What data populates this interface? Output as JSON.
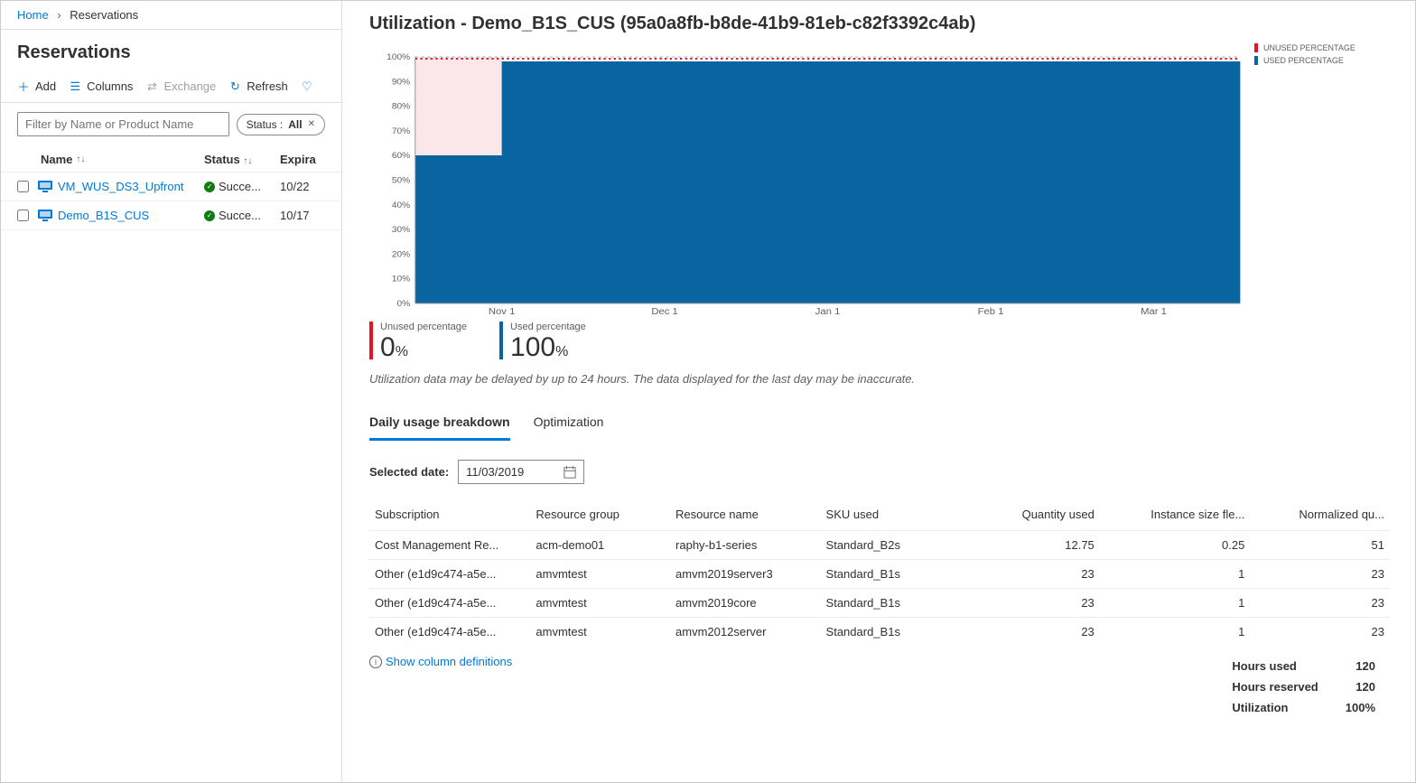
{
  "breadcrumb": {
    "home": "Home",
    "current": "Reservations"
  },
  "left": {
    "title": "Reservations",
    "toolbar": {
      "add": "Add",
      "columns": "Columns",
      "exchange": "Exchange",
      "refresh": "Refresh"
    },
    "filter_placeholder": "Filter by Name or Product Name",
    "status_pill_label": "Status :",
    "status_pill_value": "All",
    "headers": {
      "name": "Name",
      "status": "Status",
      "expir": "Expira"
    },
    "rows": [
      {
        "name": "VM_WUS_DS3_Upfront",
        "status": "Succe...",
        "expir": "10/22"
      },
      {
        "name": "Demo_B1S_CUS",
        "status": "Succe...",
        "expir": "10/17"
      }
    ]
  },
  "detail": {
    "title": "Utilization - Demo_B1S_CUS (95a0a8fb-b8de-41b9-81eb-c82f3392c4ab)",
    "legend": {
      "unused": "UNUSED PERCENTAGE",
      "used": "USED PERCENTAGE"
    },
    "metrics": {
      "unused_label": "Unused percentage",
      "unused_value": "0",
      "unused_unit": "%",
      "used_label": "Used percentage",
      "used_value": "100",
      "used_unit": "%"
    },
    "disclaimer": "Utilization data may be delayed by up to 24 hours. The data displayed for the last day may be inaccurate.",
    "tabs": {
      "breakdown": "Daily usage breakdown",
      "optimization": "Optimization"
    },
    "selected_date_label": "Selected date:",
    "selected_date_value": "11/03/2019",
    "columns": [
      "Subscription",
      "Resource group",
      "Resource name",
      "SKU used",
      "Quantity used",
      "Instance size fle...",
      "Normalized qu..."
    ],
    "usage_rows": [
      {
        "sub": "Cost Management Re...",
        "rg": "acm-demo01",
        "res": "raphy-b1-series",
        "sku": "Standard_B2s",
        "qty": "12.75",
        "flex": "0.25",
        "norm": "51"
      },
      {
        "sub": "Other (e1d9c474-a5e...",
        "rg": "amvmtest",
        "res": "amvm2019server3",
        "sku": "Standard_B1s",
        "qty": "23",
        "flex": "1",
        "norm": "23"
      },
      {
        "sub": "Other (e1d9c474-a5e...",
        "rg": "amvmtest",
        "res": "amvm2019core",
        "sku": "Standard_B1s",
        "qty": "23",
        "flex": "1",
        "norm": "23"
      },
      {
        "sub": "Other (e1d9c474-a5e...",
        "rg": "amvmtest",
        "res": "amvm2012server",
        "sku": "Standard_B1s",
        "qty": "23",
        "flex": "1",
        "norm": "23"
      }
    ],
    "defs_link": "Show column definitions",
    "summary": {
      "hours_used_label": "Hours used",
      "hours_used": "120",
      "hours_reserved_label": "Hours reserved",
      "hours_reserved": "120",
      "utilization_label": "Utilization",
      "utilization": "100%"
    },
    "colors": {
      "used": "#0a64a0",
      "unused": "#e81123",
      "unused_fill": "#fbe7ea"
    }
  },
  "chart_data": {
    "type": "area",
    "title": "Utilization - Demo_B1S_CUS",
    "xlabel": "",
    "ylabel": "",
    "ylim": [
      0,
      100
    ],
    "y_ticks": [
      "0%",
      "10%",
      "20%",
      "30%",
      "40%",
      "50%",
      "60%",
      "70%",
      "80%",
      "90%",
      "100%"
    ],
    "x_ticks": [
      "Nov 1",
      "Dec 1",
      "Jan 1",
      "Feb 1",
      "Mar 1"
    ],
    "series": [
      {
        "name": "USED PERCENTAGE",
        "color": "#0a64a0",
        "values_sample": [
          60,
          60,
          60,
          100,
          100,
          100,
          100,
          100,
          100,
          100,
          100,
          100,
          100,
          100,
          100,
          100,
          100,
          100
        ]
      },
      {
        "name": "UNUSED PERCENTAGE",
        "color": "#e81123",
        "values_sample": [
          40,
          40,
          40,
          0,
          0,
          0,
          0,
          0,
          0,
          0,
          0,
          0,
          0,
          0,
          0,
          0,
          0,
          0
        ]
      }
    ],
    "note": "Used ≈60% for ~first 2 weeks, then ~100% thereafter; unused is complement."
  }
}
